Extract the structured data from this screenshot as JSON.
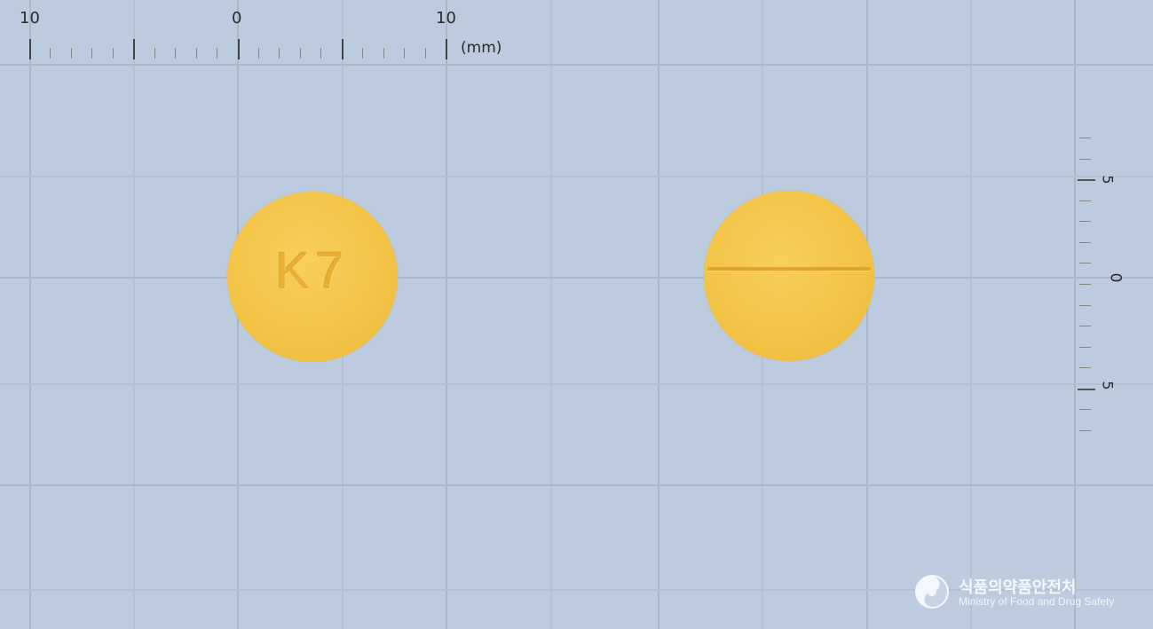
{
  "ruler_top": {
    "labels": [
      "10",
      "0",
      "10"
    ],
    "unit": "(mm)"
  },
  "ruler_right": {
    "labels": [
      "5",
      "0",
      "5"
    ]
  },
  "pills": [
    {
      "side": "front",
      "imprint": "K7",
      "color": "#f3c447",
      "shape": "round"
    },
    {
      "side": "back",
      "imprint": "",
      "score_line": true,
      "color": "#f3c447",
      "shape": "round"
    }
  ],
  "watermark": {
    "korean": "식품의약품안전처",
    "english": "Ministry of Food and Drug Safety"
  }
}
